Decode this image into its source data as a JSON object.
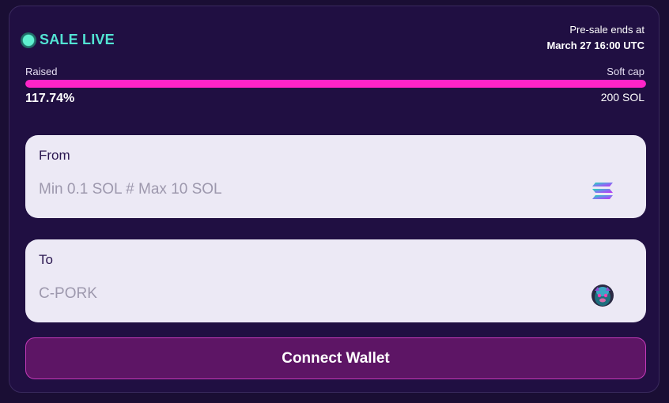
{
  "status": {
    "label": "SALE LIVE"
  },
  "presale": {
    "ends_label": "Pre-sale ends at",
    "ends_date": "March 27 16:00 UTC"
  },
  "progress": {
    "raised_label": "Raised",
    "raised_percent_text": "117.74%",
    "raised_percent": 117.74,
    "fill_fraction": 1.0,
    "softcap_label": "Soft cap",
    "softcap_value": "200 SOL"
  },
  "from_field": {
    "label": "From",
    "value": "",
    "placeholder": "Min 0.1 SOL # Max 10 SOL",
    "icon": "solana-icon"
  },
  "to_field": {
    "label": "To",
    "value": "",
    "placeholder": "C-PORK",
    "icon": "c-pork-token-icon"
  },
  "connect_button": {
    "label": "Connect Wallet"
  },
  "colors": {
    "background": "#1a0e34",
    "card": "#200f42",
    "accent_live": "#52e3d3",
    "progress_fill": "#ff24c8",
    "field_bg": "#ece9f5",
    "button_bg": "#5d1565",
    "button_border": "#c43ab8"
  }
}
